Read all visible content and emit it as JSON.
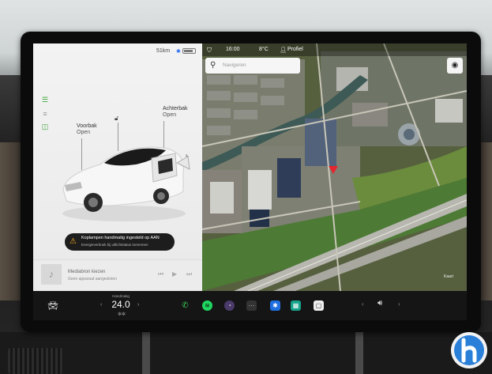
{
  "status": {
    "range": "51km"
  },
  "map_header": {
    "time": "16:00",
    "temperature": "8°C",
    "profile": "Profiel"
  },
  "labels": {
    "front_trunk": "Voorbak",
    "front_trunk_state": "Open",
    "rear_trunk": "Achterbak",
    "rear_trunk_state": "Open"
  },
  "alert": {
    "title": "Koplampen handmatig ingesteld op AAN",
    "subtitle": "Energieverbruik bij uitlichtstatus toenemen"
  },
  "media": {
    "title": "Mediabron kiezen",
    "subtitle": "Geen apparaat aangesloten"
  },
  "search": {
    "placeholder": "Navigeren"
  },
  "climate": {
    "label": "Handmatig",
    "temperature": "24.0"
  },
  "map_corner": "Kaart",
  "colors": {
    "accent_blue": "#2a6df0",
    "alert_amber": "#ffb020",
    "pin_red": "#e3262f",
    "phone_green": "#3ecf5a"
  }
}
